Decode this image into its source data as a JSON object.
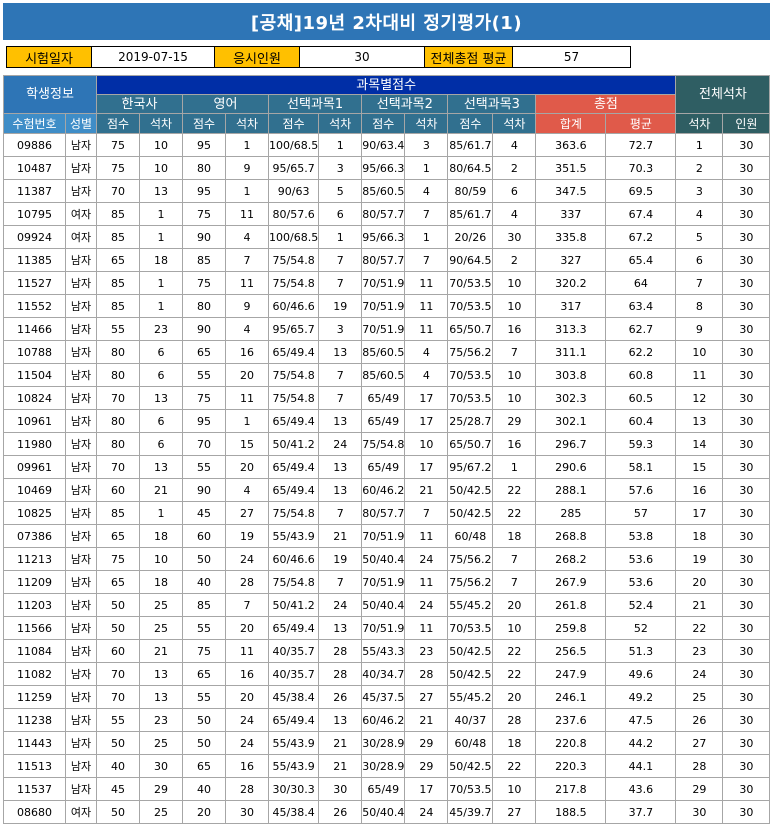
{
  "title": "[공채]19년 2차대비 정기평가(1)",
  "info": {
    "exam_date_label": "시험일자",
    "exam_date": "2019-07-15",
    "examinees_label": "응시인원",
    "examinees": "30",
    "avg_label": "전체총점 평균",
    "avg": "57"
  },
  "header": {
    "student_info": "학생정보",
    "subject_scores": "과목별점수",
    "overall_rank": "전체석차",
    "subjects": [
      "한국사",
      "영어",
      "선택과목1",
      "선택과목2",
      "선택과목3"
    ],
    "total_group": "총점",
    "exam_no": "수험번호",
    "gender": "성별",
    "score": "점수",
    "rank": "석차",
    "sum": "합계",
    "average": "평균",
    "rank2": "석차",
    "count": "인원"
  },
  "rows": [
    [
      "09886",
      "남자",
      "75",
      "10",
      "95",
      "1",
      "100/68.5",
      "1",
      "90/63.4",
      "3",
      "85/61.7",
      "4",
      "363.6",
      "72.7",
      "1",
      "30"
    ],
    [
      "10487",
      "남자",
      "75",
      "10",
      "80",
      "9",
      "95/65.7",
      "3",
      "95/66.3",
      "1",
      "80/64.5",
      "2",
      "351.5",
      "70.3",
      "2",
      "30"
    ],
    [
      "11387",
      "남자",
      "70",
      "13",
      "95",
      "1",
      "90/63",
      "5",
      "85/60.5",
      "4",
      "80/59",
      "6",
      "347.5",
      "69.5",
      "3",
      "30"
    ],
    [
      "10795",
      "여자",
      "85",
      "1",
      "75",
      "11",
      "80/57.6",
      "6",
      "80/57.7",
      "7",
      "85/61.7",
      "4",
      "337",
      "67.4",
      "4",
      "30"
    ],
    [
      "09924",
      "여자",
      "85",
      "1",
      "90",
      "4",
      "100/68.5",
      "1",
      "95/66.3",
      "1",
      "20/26",
      "30",
      "335.8",
      "67.2",
      "5",
      "30"
    ],
    [
      "11385",
      "남자",
      "65",
      "18",
      "85",
      "7",
      "75/54.8",
      "7",
      "80/57.7",
      "7",
      "90/64.5",
      "2",
      "327",
      "65.4",
      "6",
      "30"
    ],
    [
      "11527",
      "남자",
      "85",
      "1",
      "75",
      "11",
      "75/54.8",
      "7",
      "70/51.9",
      "11",
      "70/53.5",
      "10",
      "320.2",
      "64",
      "7",
      "30"
    ],
    [
      "11552",
      "남자",
      "85",
      "1",
      "80",
      "9",
      "60/46.6",
      "19",
      "70/51.9",
      "11",
      "70/53.5",
      "10",
      "317",
      "63.4",
      "8",
      "30"
    ],
    [
      "11466",
      "남자",
      "55",
      "23",
      "90",
      "4",
      "95/65.7",
      "3",
      "70/51.9",
      "11",
      "65/50.7",
      "16",
      "313.3",
      "62.7",
      "9",
      "30"
    ],
    [
      "10788",
      "남자",
      "80",
      "6",
      "65",
      "16",
      "65/49.4",
      "13",
      "85/60.5",
      "4",
      "75/56.2",
      "7",
      "311.1",
      "62.2",
      "10",
      "30"
    ],
    [
      "11504",
      "남자",
      "80",
      "6",
      "55",
      "20",
      "75/54.8",
      "7",
      "85/60.5",
      "4",
      "70/53.5",
      "10",
      "303.8",
      "60.8",
      "11",
      "30"
    ],
    [
      "10824",
      "남자",
      "70",
      "13",
      "75",
      "11",
      "75/54.8",
      "7",
      "65/49",
      "17",
      "70/53.5",
      "10",
      "302.3",
      "60.5",
      "12",
      "30"
    ],
    [
      "10961",
      "남자",
      "80",
      "6",
      "95",
      "1",
      "65/49.4",
      "13",
      "65/49",
      "17",
      "25/28.7",
      "29",
      "302.1",
      "60.4",
      "13",
      "30"
    ],
    [
      "11980",
      "남자",
      "80",
      "6",
      "70",
      "15",
      "50/41.2",
      "24",
      "75/54.8",
      "10",
      "65/50.7",
      "16",
      "296.7",
      "59.3",
      "14",
      "30"
    ],
    [
      "09961",
      "남자",
      "70",
      "13",
      "55",
      "20",
      "65/49.4",
      "13",
      "65/49",
      "17",
      "95/67.2",
      "1",
      "290.6",
      "58.1",
      "15",
      "30"
    ],
    [
      "10469",
      "남자",
      "60",
      "21",
      "90",
      "4",
      "65/49.4",
      "13",
      "60/46.2",
      "21",
      "50/42.5",
      "22",
      "288.1",
      "57.6",
      "16",
      "30"
    ],
    [
      "10825",
      "남자",
      "85",
      "1",
      "45",
      "27",
      "75/54.8",
      "7",
      "80/57.7",
      "7",
      "50/42.5",
      "22",
      "285",
      "57",
      "17",
      "30"
    ],
    [
      "07386",
      "남자",
      "65",
      "18",
      "60",
      "19",
      "55/43.9",
      "21",
      "70/51.9",
      "11",
      "60/48",
      "18",
      "268.8",
      "53.8",
      "18",
      "30"
    ],
    [
      "11213",
      "남자",
      "75",
      "10",
      "50",
      "24",
      "60/46.6",
      "19",
      "50/40.4",
      "24",
      "75/56.2",
      "7",
      "268.2",
      "53.6",
      "19",
      "30"
    ],
    [
      "11209",
      "남자",
      "65",
      "18",
      "40",
      "28",
      "75/54.8",
      "7",
      "70/51.9",
      "11",
      "75/56.2",
      "7",
      "267.9",
      "53.6",
      "20",
      "30"
    ],
    [
      "11203",
      "남자",
      "50",
      "25",
      "85",
      "7",
      "50/41.2",
      "24",
      "50/40.4",
      "24",
      "55/45.2",
      "20",
      "261.8",
      "52.4",
      "21",
      "30"
    ],
    [
      "11566",
      "남자",
      "50",
      "25",
      "55",
      "20",
      "65/49.4",
      "13",
      "70/51.9",
      "11",
      "70/53.5",
      "10",
      "259.8",
      "52",
      "22",
      "30"
    ],
    [
      "11084",
      "남자",
      "60",
      "21",
      "75",
      "11",
      "40/35.7",
      "28",
      "55/43.3",
      "23",
      "50/42.5",
      "22",
      "256.5",
      "51.3",
      "23",
      "30"
    ],
    [
      "11082",
      "남자",
      "70",
      "13",
      "65",
      "16",
      "40/35.7",
      "28",
      "40/34.7",
      "28",
      "50/42.5",
      "22",
      "247.9",
      "49.6",
      "24",
      "30"
    ],
    [
      "11259",
      "남자",
      "70",
      "13",
      "55",
      "20",
      "45/38.4",
      "26",
      "45/37.5",
      "27",
      "55/45.2",
      "20",
      "246.1",
      "49.2",
      "25",
      "30"
    ],
    [
      "11238",
      "남자",
      "55",
      "23",
      "50",
      "24",
      "65/49.4",
      "13",
      "60/46.2",
      "21",
      "40/37",
      "28",
      "237.6",
      "47.5",
      "26",
      "30"
    ],
    [
      "11443",
      "남자",
      "50",
      "25",
      "50",
      "24",
      "55/43.9",
      "21",
      "30/28.9",
      "29",
      "60/48",
      "18",
      "220.8",
      "44.2",
      "27",
      "30"
    ],
    [
      "11513",
      "남자",
      "40",
      "30",
      "65",
      "16",
      "55/43.9",
      "21",
      "30/28.9",
      "29",
      "50/42.5",
      "22",
      "220.3",
      "44.1",
      "28",
      "30"
    ],
    [
      "11537",
      "남자",
      "45",
      "29",
      "40",
      "28",
      "30/30.3",
      "30",
      "65/49",
      "17",
      "70/53.5",
      "10",
      "217.8",
      "43.6",
      "29",
      "30"
    ],
    [
      "08680",
      "여자",
      "50",
      "25",
      "20",
      "30",
      "45/38.4",
      "26",
      "50/40.4",
      "24",
      "45/39.7",
      "27",
      "188.5",
      "37.7",
      "30",
      "30"
    ]
  ]
}
